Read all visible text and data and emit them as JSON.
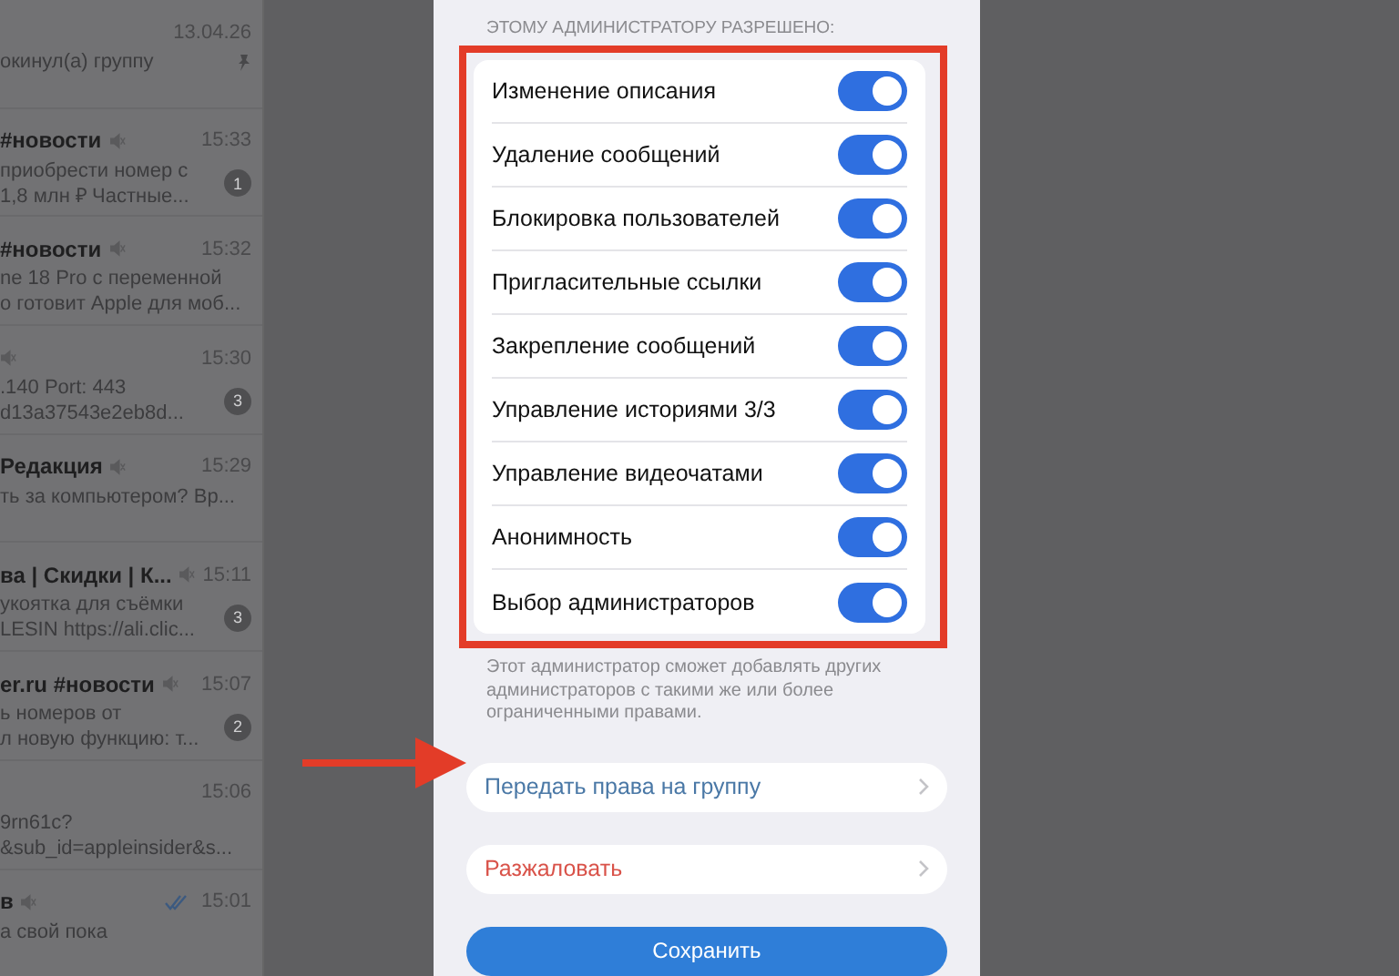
{
  "chat_list": [
    {
      "time": "13.04.26",
      "lines": [
        "окинул(а) группу"
      ],
      "pinned": true,
      "muted": false,
      "read": false
    },
    {
      "title": "#новости",
      "time": "15:33",
      "lines": [
        "приобрести номер с",
        "1,8 млн ₽  Частные..."
      ],
      "badge": "1",
      "pinned": false,
      "muted": true,
      "read": false
    },
    {
      "title": "#новости",
      "time": "15:32",
      "lines": [
        "ne 18 Pro с переменной",
        "о готовит Apple для моб..."
      ],
      "pinned": false,
      "muted": true,
      "read": false
    },
    {
      "time": "15:30",
      "lines": [
        ".140 Port: 443",
        "d13a37543e2eb8d..."
      ],
      "badge": "3",
      "pinned": false,
      "muted": true,
      "read": false
    },
    {
      "title": "Редакция",
      "time": "15:29",
      "lines": [
        "ть за компьютером? Вр..."
      ],
      "pinned": false,
      "muted": true,
      "read": false
    },
    {
      "title": "ва | Скидки | К...",
      "time": "15:11",
      "lines": [
        "укоятка для съёмки",
        "LESIN  https://ali.clic..."
      ],
      "badge": "3",
      "pinned": false,
      "muted": true,
      "read": false
    },
    {
      "title": "er.ru #новости",
      "time": "15:07",
      "lines": [
        "ь номеров от",
        "л новую функцию: т..."
      ],
      "badge": "2",
      "pinned": false,
      "muted": true,
      "read": false
    },
    {
      "time": "15:06",
      "lines": [
        "9rn61c?",
        "&sub_id=appleinsider&s..."
      ],
      "pinned": false,
      "muted": false,
      "read": false
    },
    {
      "title": "в",
      "time": "15:01",
      "lines": [
        "а свой пока"
      ],
      "pinned": false,
      "muted": true,
      "read": true
    }
  ],
  "modal": {
    "section_header": "ЭТОМУ АДМИНИСТРАТОРУ РАЗРЕШЕНО:",
    "permissions": [
      {
        "label": "Изменение описания",
        "on": true
      },
      {
        "label": "Удаление сообщений",
        "on": true
      },
      {
        "label": "Блокировка пользователей",
        "on": true
      },
      {
        "label": "Пригласительные ссылки",
        "on": true
      },
      {
        "label": "Закрепление сообщений",
        "on": true
      },
      {
        "label": "Управление историями 3/3",
        "on": true
      },
      {
        "label": "Управление видеочатами",
        "on": true
      },
      {
        "label": "Анонимность",
        "on": true
      },
      {
        "label": "Выбор администраторов",
        "on": true
      }
    ],
    "footnote": "Этот администратор сможет добавлять других администраторов с такими же или более ограниченными правами.",
    "actions": [
      {
        "label": "Передать права на группу",
        "kind": "link"
      },
      {
        "label": "Разжаловать",
        "kind": "danger"
      }
    ],
    "save_button": "Сохранить"
  }
}
